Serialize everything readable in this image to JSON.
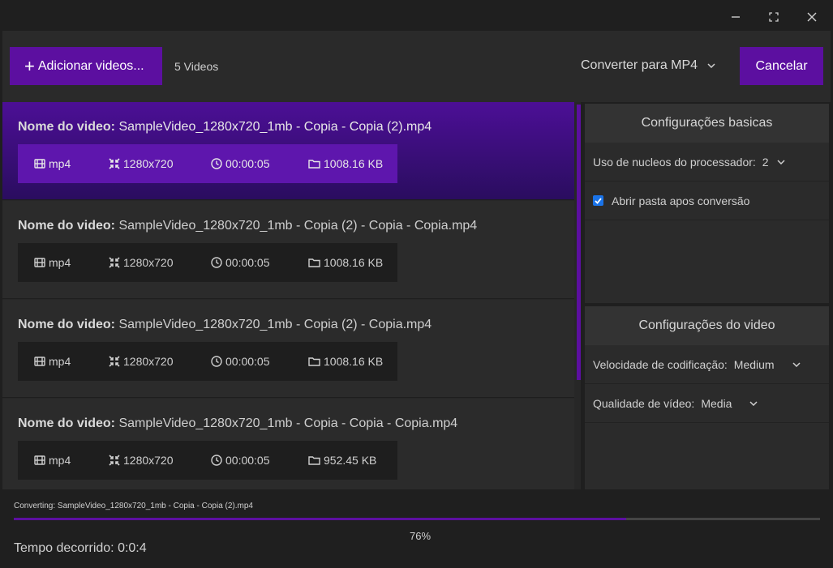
{
  "window": {
    "minimize_icon": "minimize-icon",
    "maximize_icon": "maximize-icon",
    "close_icon": "close-icon"
  },
  "toolbar": {
    "add_label": "Adicionar videos...",
    "video_count": "5 Videos",
    "convert_label": "Converter para MP4",
    "cancel_label": "Cancelar"
  },
  "videos": [
    {
      "label": "Nome do video:",
      "filename": "SampleVideo_1280x720_1mb - Copia - Copia (2).mp4",
      "format": "mp4",
      "resolution": "1280x720",
      "duration": "00:00:05",
      "size": "1008.16 KB",
      "selected": true
    },
    {
      "label": "Nome do video:",
      "filename": "SampleVideo_1280x720_1mb - Copia (2) - Copia - Copia.mp4",
      "format": "mp4",
      "resolution": "1280x720",
      "duration": "00:00:05",
      "size": "1008.16 KB",
      "selected": false
    },
    {
      "label": "Nome do video:",
      "filename": "SampleVideo_1280x720_1mb - Copia (2) - Copia.mp4",
      "format": "mp4",
      "resolution": "1280x720",
      "duration": "00:00:05",
      "size": "1008.16 KB",
      "selected": false
    },
    {
      "label": "Nome do video:",
      "filename": "SampleVideo_1280x720_1mb - Copia - Copia - Copia.mp4",
      "format": "mp4",
      "resolution": "1280x720",
      "duration": "00:00:05",
      "size": "952.45 KB",
      "selected": false
    }
  ],
  "basic_settings": {
    "title": "Configurações basicas",
    "cores_label": "Uso de nucleos do processador:",
    "cores_value": "2",
    "open_folder_label": "Abrir pasta apos conversão",
    "open_folder_checked": true
  },
  "video_settings": {
    "title": "Configurações do video",
    "speed_label": "Velocidade de codificação:",
    "speed_value": "Medium",
    "quality_label": "Qualidade de vídeo:",
    "quality_value": "Media"
  },
  "status": {
    "converting_text": "Converting: SampleVideo_1280x720_1mb - Copia - Copia (2).mp4",
    "progress_percent": 76,
    "percent_label": "76%",
    "elapsed_text": "Tempo decorrido: 0:0:4"
  },
  "colors": {
    "accent": "#5c0fa0",
    "checkbox": "#1a73e8",
    "background": "#1f1f1f"
  }
}
